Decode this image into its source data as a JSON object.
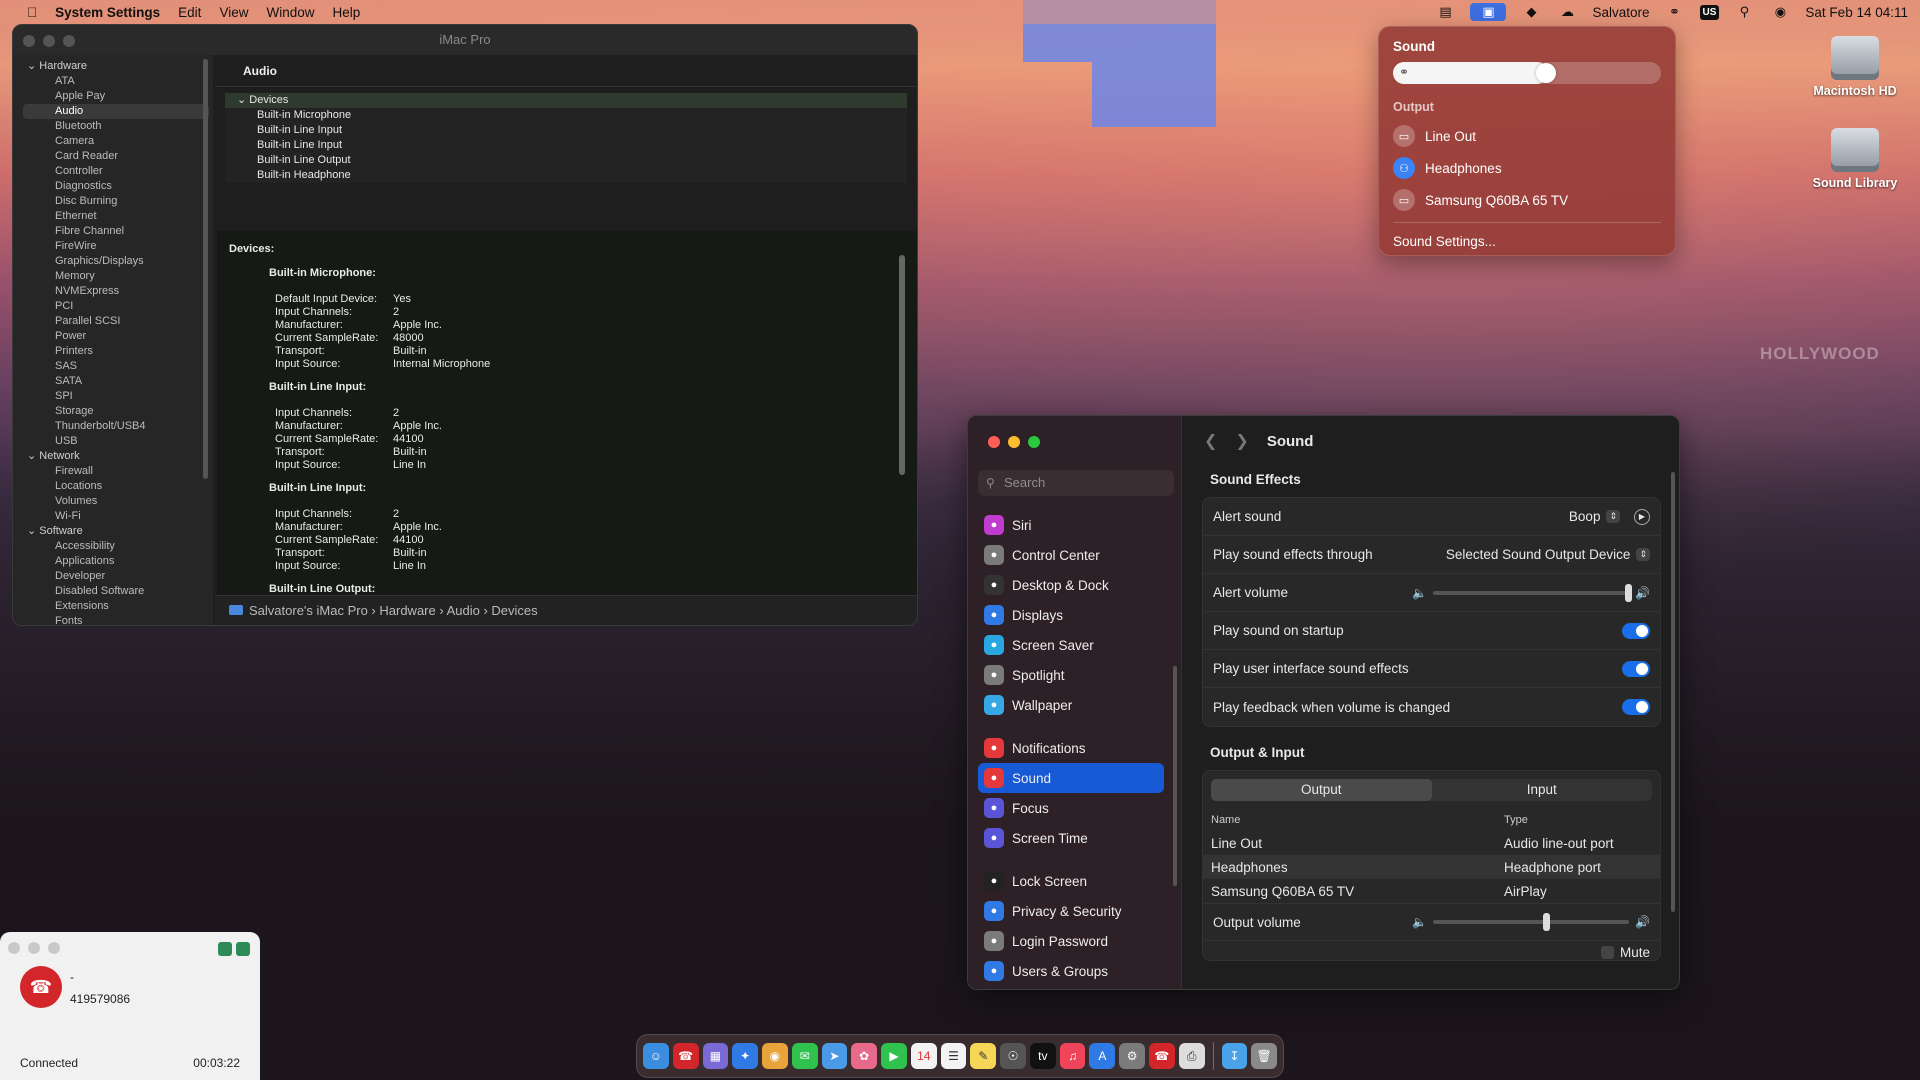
{
  "menubar": {
    "app": "System Settings",
    "menus": [
      "Edit",
      "View",
      "Window",
      "Help"
    ],
    "user": "Salvatore",
    "kb": "US",
    "datetime": "Sat Feb 14  04:11"
  },
  "desktop": {
    "icons": [
      "Macintosh HD",
      "Sound Library"
    ],
    "sign": "HOLLYWOOD"
  },
  "sysinfo": {
    "title": "iMac Pro",
    "sidebar": [
      {
        "k": "grp",
        "t": "Hardware"
      },
      {
        "k": "it",
        "t": "ATA"
      },
      {
        "k": "it",
        "t": "Apple Pay"
      },
      {
        "k": "sel",
        "t": "Audio"
      },
      {
        "k": "it",
        "t": "Bluetooth"
      },
      {
        "k": "it",
        "t": "Camera"
      },
      {
        "k": "it",
        "t": "Card Reader"
      },
      {
        "k": "it",
        "t": "Controller"
      },
      {
        "k": "it",
        "t": "Diagnostics"
      },
      {
        "k": "it",
        "t": "Disc Burning"
      },
      {
        "k": "it",
        "t": "Ethernet"
      },
      {
        "k": "it",
        "t": "Fibre Channel"
      },
      {
        "k": "it",
        "t": "FireWire"
      },
      {
        "k": "it",
        "t": "Graphics/Displays"
      },
      {
        "k": "it",
        "t": "Memory"
      },
      {
        "k": "it",
        "t": "NVMExpress"
      },
      {
        "k": "it",
        "t": "PCI"
      },
      {
        "k": "it",
        "t": "Parallel SCSI"
      },
      {
        "k": "it",
        "t": "Power"
      },
      {
        "k": "it",
        "t": "Printers"
      },
      {
        "k": "it",
        "t": "SAS"
      },
      {
        "k": "it",
        "t": "SATA"
      },
      {
        "k": "it",
        "t": "SPI"
      },
      {
        "k": "it",
        "t": "Storage"
      },
      {
        "k": "it",
        "t": "Thunderbolt/USB4"
      },
      {
        "k": "it",
        "t": "USB"
      },
      {
        "k": "grp",
        "t": "Network"
      },
      {
        "k": "it",
        "t": "Firewall"
      },
      {
        "k": "it",
        "t": "Locations"
      },
      {
        "k": "it",
        "t": "Volumes"
      },
      {
        "k": "it",
        "t": "Wi-Fi"
      },
      {
        "k": "grp",
        "t": "Software"
      },
      {
        "k": "it",
        "t": "Accessibility"
      },
      {
        "k": "it",
        "t": "Applications"
      },
      {
        "k": "it",
        "t": "Developer"
      },
      {
        "k": "it",
        "t": "Disabled Software"
      },
      {
        "k": "it",
        "t": "Extensions"
      },
      {
        "k": "it",
        "t": "Fonts"
      }
    ],
    "section": "Audio",
    "tree_root": "Devices",
    "tree": [
      "Built-in Microphone",
      "Built-in Line Input",
      "Built-in Line Input",
      "Built-in Line Output",
      "Built-in Headphone"
    ],
    "detail_header": "Devices:",
    "devices": [
      {
        "name": "Built-in Microphone:",
        "props": [
          [
            "Default Input Device:",
            "Yes"
          ],
          [
            "Input Channels:",
            "2"
          ],
          [
            "Manufacturer:",
            "Apple Inc."
          ],
          [
            "Current SampleRate:",
            "48000"
          ],
          [
            "Transport:",
            "Built-in"
          ],
          [
            "Input Source:",
            "Internal Microphone"
          ]
        ]
      },
      {
        "name": "Built-in Line Input:",
        "props": [
          [
            "Input Channels:",
            "2"
          ],
          [
            "Manufacturer:",
            "Apple Inc."
          ],
          [
            "Current SampleRate:",
            "44100"
          ],
          [
            "Transport:",
            "Built-in"
          ],
          [
            "Input Source:",
            "Line In"
          ]
        ]
      },
      {
        "name": "Built-in Line Input:",
        "props": [
          [
            "Input Channels:",
            "2"
          ],
          [
            "Manufacturer:",
            "Apple Inc."
          ],
          [
            "Current SampleRate:",
            "44100"
          ],
          [
            "Transport:",
            "Built-in"
          ],
          [
            "Input Source:",
            "Line In"
          ]
        ]
      },
      {
        "name": "Built-in Line Output:",
        "props": []
      }
    ],
    "path": [
      "Salvatore's iMac Pro",
      "Hardware",
      "Audio",
      "Devices"
    ]
  },
  "popover": {
    "title": "Sound",
    "volume_fraction": 0.58,
    "output_label": "Output",
    "outputs": [
      "Line Out",
      "Headphones",
      "Samsung Q60BA 65 TV"
    ],
    "selected": 1,
    "settings": "Sound Settings..."
  },
  "settings": {
    "search_placeholder": "Search",
    "title": "Sound",
    "sidebar": [
      [
        "Siri",
        "#c03ccf"
      ],
      [
        "Control Center",
        "#7b7b7b"
      ],
      [
        "Desktop & Dock",
        "#333"
      ],
      [
        "Displays",
        "#2f7ae5"
      ],
      [
        "Screen Saver",
        "#29a7e0"
      ],
      [
        "Spotlight",
        "#7b7b7b"
      ],
      [
        "Wallpaper",
        "#37a8e6"
      ],
      null,
      [
        "Notifications",
        "#e5383b"
      ],
      [
        "Sound",
        "#e5383b"
      ],
      [
        "Focus",
        "#5a55d6"
      ],
      [
        "Screen Time",
        "#5a55d6"
      ],
      null,
      [
        "Lock Screen",
        "#222"
      ],
      [
        "Privacy & Security",
        "#2f7ae5"
      ],
      [
        "Login Password",
        "#7b7b7b"
      ],
      [
        "Users & Groups",
        "#2f7ae5"
      ]
    ],
    "selected": "Sound",
    "effects_title": "Sound Effects",
    "alert_sound_label": "Alert sound",
    "alert_sound": "Boop",
    "through_label": "Play sound effects through",
    "through": "Selected Sound Output Device",
    "alert_volume_label": "Alert volume",
    "alert_volume": 1.0,
    "toggles": [
      "Play sound on startup",
      "Play user interface sound effects",
      "Play feedback when volume is changed"
    ],
    "oi_title": "Output & Input",
    "tabs": [
      "Output",
      "Input"
    ],
    "col_name": "Name",
    "col_type": "Type",
    "rows": [
      [
        "Line Out",
        "Audio line-out port"
      ],
      [
        "Headphones",
        "Headphone port"
      ],
      [
        "Samsung Q60BA 65 TV",
        "AirPlay"
      ]
    ],
    "selected_row": 1,
    "output_volume_label": "Output volume",
    "output_volume": 0.58,
    "mute": "Mute"
  },
  "call": {
    "name": "-",
    "number": "419579086",
    "status": "Connected",
    "time": "00:03:22"
  }
}
